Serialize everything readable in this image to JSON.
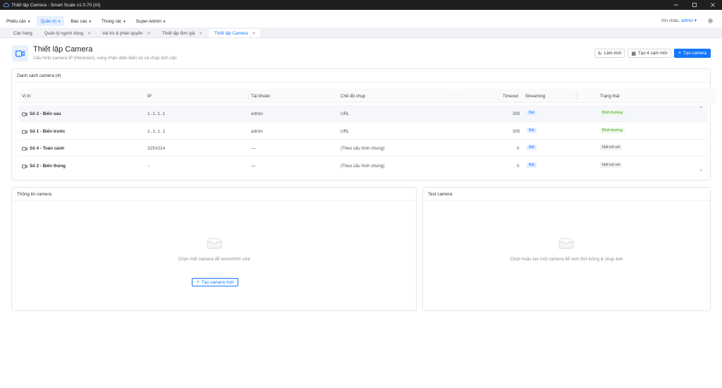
{
  "window": {
    "title": "Thiết lập Camera - Smart Scale v1.0.70 (AI)"
  },
  "menu": {
    "items": [
      {
        "label": "Phiếu cân"
      },
      {
        "label": "Quản trị"
      },
      {
        "label": "Báo cáo"
      },
      {
        "label": "Thùng rác"
      },
      {
        "label": "Super Admin"
      }
    ],
    "greeting": "Xin chào,",
    "user": "admin"
  },
  "tabs": [
    {
      "label": "Cân hàng"
    },
    {
      "label": "Quản lý người dùng"
    },
    {
      "label": "Vai trò & phân quyền"
    },
    {
      "label": "Thiết lập đơn giá"
    },
    {
      "label": "Thiết lập Camera"
    }
  ],
  "header": {
    "title": "Thiết lập Camera",
    "subtitle": "Cấu hình camera IP (Hikvision), vùng nhận diện biển số và chụp ảnh cân",
    "refresh_label": "Làm mới",
    "create4_label": "Tạo 4 cam mới",
    "create_label": "Tạo camera"
  },
  "camera_list": {
    "title": "Danh sách camera (4)",
    "columns": [
      "Vị trí",
      "IP",
      "Tài khoản",
      "Chế độ chụp",
      "Timeout",
      "Streaming",
      "Trạng thái"
    ],
    "rows": [
      {
        "location": "Số 3 - Biển sau",
        "ip": "1.1.1.1",
        "account": "admin",
        "mode": "URL",
        "timeout": "300",
        "streaming": "Bật",
        "status": "Bình thường",
        "status_type": "ok"
      },
      {
        "location": "Số 1 - Biển trước",
        "ip": "1.1.1.1",
        "account": "admin",
        "mode": "URL",
        "timeout": "300",
        "streaming": "Bật",
        "status": "Bình thường",
        "status_type": "ok"
      },
      {
        "location": "Số 4 - Toàn cảnh",
        "ip": "3254324",
        "account": "—",
        "mode": "(Theo cấu hình chung)",
        "timeout": "0",
        "streaming": "Bật",
        "status": "Mất kết nối",
        "status_type": "off"
      },
      {
        "location": "Số 2 - Biển thùng",
        "ip": "–",
        "account": "—",
        "mode": "(Theo cấu hình chung)",
        "timeout": "0",
        "streaming": "Bật",
        "status": "Mất kết nối",
        "status_type": "off"
      }
    ]
  },
  "camera_info": {
    "title": "Thông tin camera",
    "empty_text": "Chọn một camera để xem/chỉnh sửa",
    "create_label": "Tạo camera mới"
  },
  "test_camera": {
    "title": "Test camera",
    "empty_text": "Chọn hoặc tạo một camera để xem thử luồng & chụp ảnh"
  },
  "colors": {
    "accent": "#1677ff",
    "ok": "#389e0d",
    "titlebar": "#1f1f1f"
  },
  "icons": [
    "cloud-icon",
    "minimize-icon",
    "maximize-icon",
    "close-icon",
    "gear-icon",
    "camera-icon",
    "refresh-icon",
    "plus-icon",
    "video-icon",
    "empty-box-icon"
  ]
}
